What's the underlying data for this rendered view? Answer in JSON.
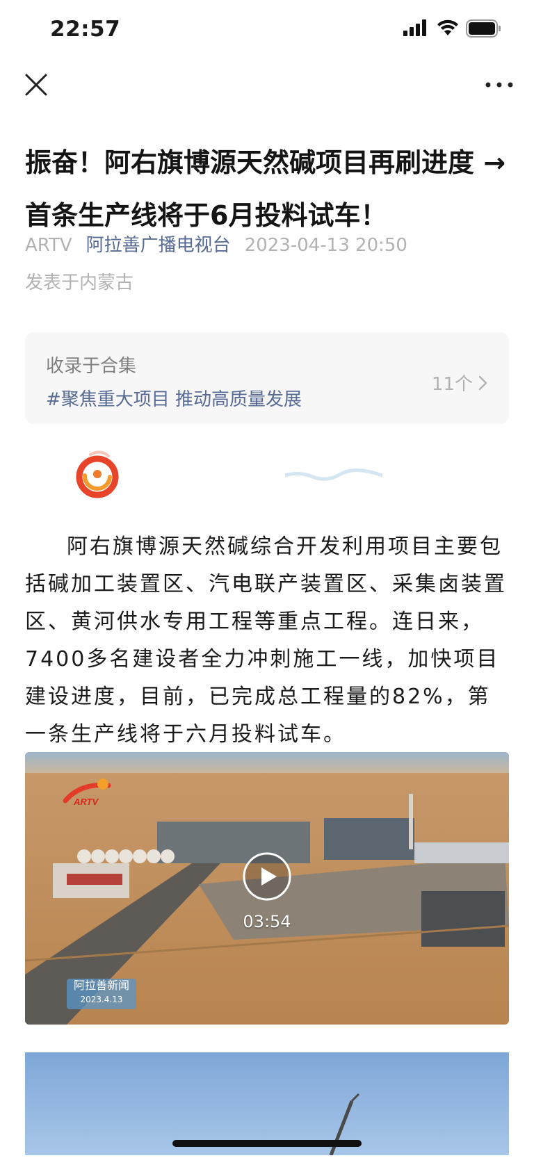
{
  "status_bar": {
    "time": "22:57"
  },
  "article": {
    "title": "振奋！阿右旗博源天然碱项目再刷进度 →首条生产线将于6月投料试车！",
    "account_tag": "ARTV",
    "author": "阿拉善广播电视台",
    "datetime": "2023-04-13 20:50",
    "location": "发表于内蒙古",
    "body": "阿右旗博源天然碱综合开发利用项目主要包括碱加工装置区、汽电联产装置区、采集卤装置区、黄河供水专用工程等重点工程。连日来，7400多名建设者全力冲刺施工一线，加快项目建设进度，目前，已完成总工程量的82%，第一条生产线将于六月投料试车。"
  },
  "collection": {
    "label": "收录于合集",
    "name": "#聚焦重大项目 推动高质量发展",
    "count": "11个"
  },
  "video": {
    "duration": "03:54",
    "logo_text": "ARTV",
    "watermark_title": "阿拉善新闻",
    "watermark_date": "2023.4.13"
  },
  "colors": {
    "link": "#576b95",
    "meta": "#b2b2b2",
    "card_bg": "#f7f7f7"
  },
  "icons": [
    "close-icon",
    "more-icon",
    "chevron-right-icon",
    "play-icon",
    "signal-icon",
    "wifi-icon",
    "battery-icon"
  ]
}
